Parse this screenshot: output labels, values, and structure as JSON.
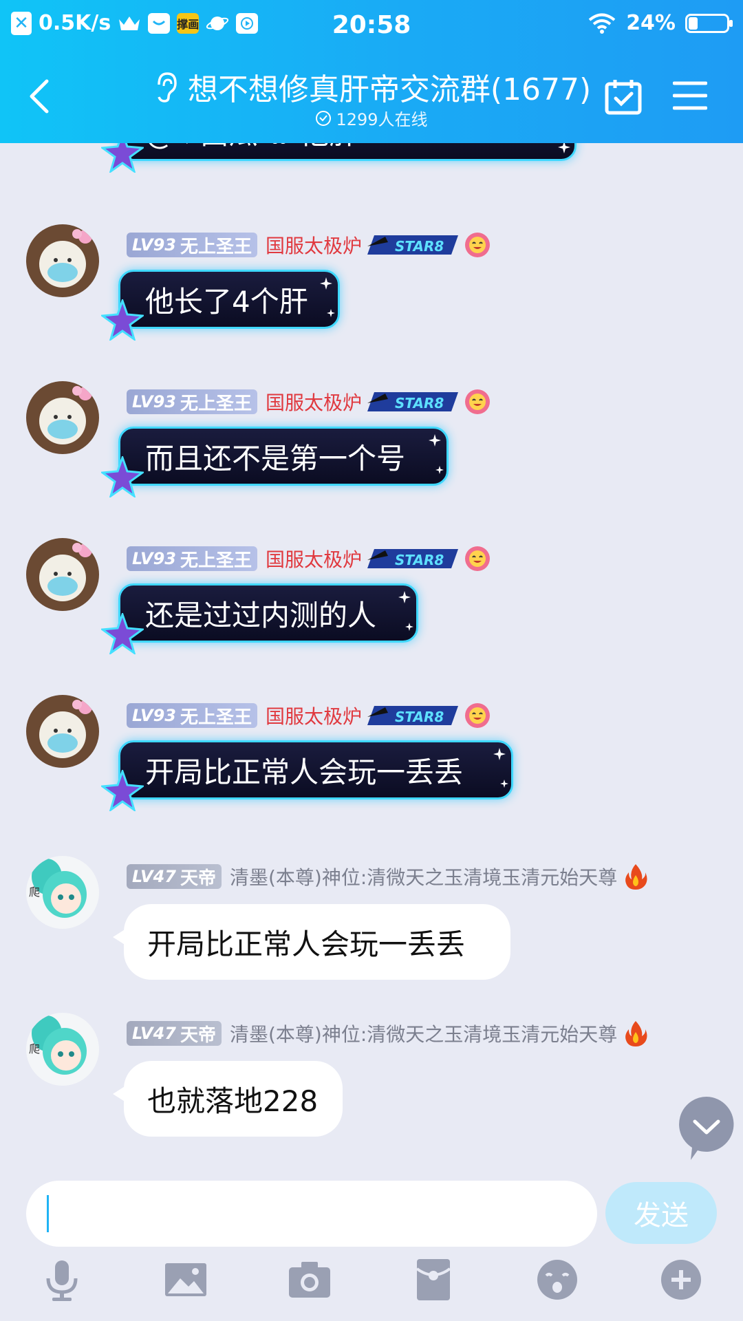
{
  "status_bar": {
    "net_speed": "0.5K/s",
    "app_badge_text": "撑画",
    "time": "20:58",
    "battery_text": "24%",
    "battery_level": 0.24
  },
  "header": {
    "title": "想不想修真肝帝交流群(1677)",
    "online": "1299人在线"
  },
  "messages": [
    {
      "level": "LV93",
      "rank": "无上圣王",
      "name": "国服太极炉",
      "star_text": "STAR8",
      "text": "他长了4个肝"
    },
    {
      "level": "LV93",
      "rank": "无上圣王",
      "name": "国服太极炉",
      "star_text": "STAR8",
      "text": "而且还不是第一个号"
    },
    {
      "level": "LV93",
      "rank": "无上圣王",
      "name": "国服太极炉",
      "star_text": "STAR8",
      "text": "还是过过内测的人"
    },
    {
      "level": "LV93",
      "rank": "无上圣王",
      "name": "国服太极炉",
      "star_text": "STAR8",
      "text": "开局比正常人会玩一丢丢"
    },
    {
      "level": "LV47",
      "rank": "天帝",
      "name": "清墨(本尊)神位:清微天之玉清境玉清元始天尊",
      "text": "开局比正常人会玩一丢丢"
    },
    {
      "level": "LV47",
      "rank": "天帝",
      "name": "清墨(本尊)神位:清微天之玉清境玉清元始天尊",
      "text": "也就落地228"
    }
  ],
  "partial_message": {
    "text": "@♡西瓜  ❀ 他肝"
  },
  "input": {
    "placeholder": "",
    "send_label": "发送"
  },
  "colors": {
    "accent": "#1aaaf5",
    "vip_name": "#e0393f",
    "bubble_glow": "#3fd8ff"
  }
}
